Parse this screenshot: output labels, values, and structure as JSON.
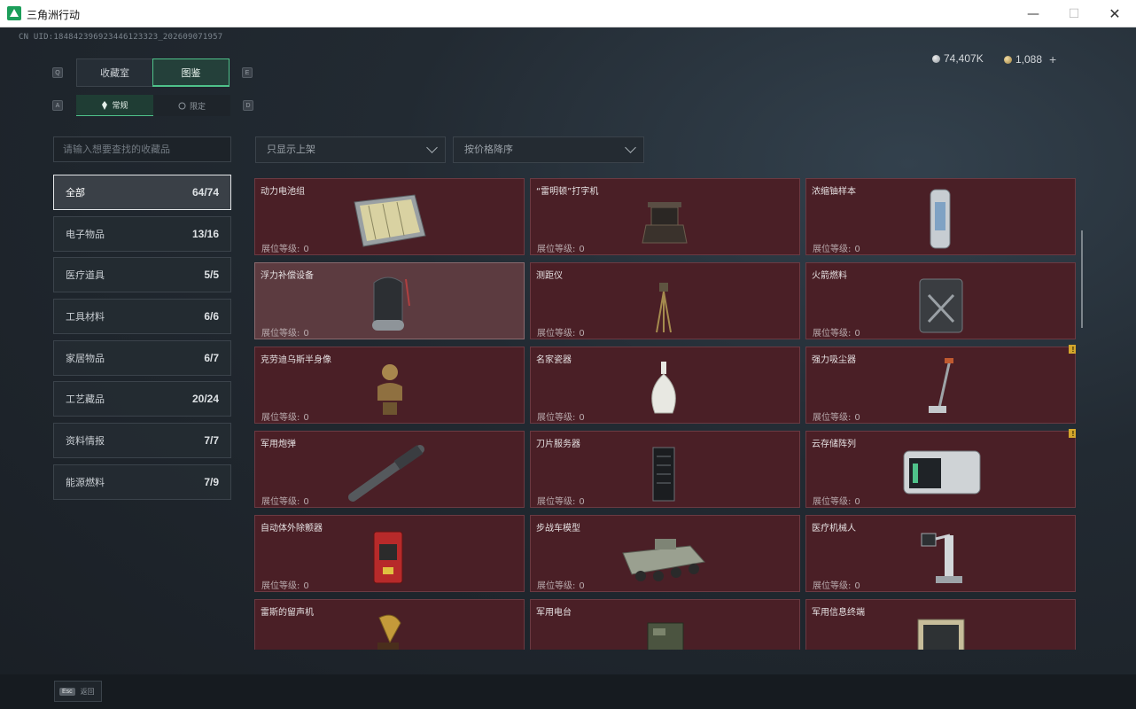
{
  "window": {
    "title": "三角洲行动",
    "minimize": "—",
    "maximize": "☐",
    "close": "✕"
  },
  "header": {
    "uid": "CN UID:1848423969234461233​23_202609071957",
    "silver": "74,407K",
    "gold": "1,088",
    "plus": "+",
    "keys": {
      "q": "Q",
      "e": "E",
      "a": "A",
      "d": "D"
    }
  },
  "tabs": {
    "collection": "收藏室",
    "atlas": "图鉴"
  },
  "subtabs": {
    "regular": "常规",
    "limited": "限定"
  },
  "search": {
    "placeholder": "请输入想要查找的收藏品"
  },
  "filters": {
    "shelf": "只显示上架",
    "sort": "按价格降序"
  },
  "categories": [
    {
      "label": "全部",
      "count": "64/74"
    },
    {
      "label": "电子物品",
      "count": "13/16"
    },
    {
      "label": "医疗道具",
      "count": "5/5"
    },
    {
      "label": "工具材料",
      "count": "6/6"
    },
    {
      "label": "家居物品",
      "count": "6/7"
    },
    {
      "label": "工艺藏品",
      "count": "20/24"
    },
    {
      "label": "资料情报",
      "count": "7/7"
    },
    {
      "label": "能源燃料",
      "count": "7/9"
    }
  ],
  "level_label": "展位等级:",
  "items": [
    {
      "name": "动力电池组",
      "level": "0",
      "icon": "battery-pack-icon"
    },
    {
      "name": "“雷明顿”打字机",
      "level": "0",
      "icon": "typewriter-icon"
    },
    {
      "name": "浓缩铀样本",
      "level": "0",
      "icon": "uranium-sample-icon"
    },
    {
      "name": "浮力补偿设备",
      "level": "0",
      "icon": "buoyancy-device-icon"
    },
    {
      "name": "测距仪",
      "level": "0",
      "icon": "rangefinder-icon"
    },
    {
      "name": "火箭燃料",
      "level": "0",
      "icon": "rocket-fuel-icon"
    },
    {
      "name": "克劳迪乌斯半身像",
      "level": "0",
      "icon": "bust-statue-icon"
    },
    {
      "name": "名家瓷器",
      "level": "0",
      "icon": "porcelain-vase-icon"
    },
    {
      "name": "强力吸尘器",
      "level": "0",
      "icon": "vacuum-cleaner-icon"
    },
    {
      "name": "军用炮弹",
      "level": "0",
      "icon": "artillery-shell-icon"
    },
    {
      "name": "刀片服务器",
      "level": "0",
      "icon": "blade-server-icon"
    },
    {
      "name": "云存储阵列",
      "level": "0",
      "icon": "storage-array-icon"
    },
    {
      "name": "自动体外除颤器",
      "level": "0",
      "icon": "defibrillator-icon"
    },
    {
      "name": "步战车模型",
      "level": "0",
      "icon": "ifv-model-icon"
    },
    {
      "name": "医疗机械人",
      "level": "0",
      "icon": "medical-robot-icon"
    },
    {
      "name": "雷斯的留声机",
      "level": "",
      "icon": "gramophone-icon"
    },
    {
      "name": "军用电台",
      "level": "",
      "icon": "military-radio-icon"
    },
    {
      "name": "军用信息终端",
      "level": "",
      "icon": "info-terminal-icon"
    }
  ],
  "warn_mark": "!",
  "footer": {
    "esc_key": "Esc",
    "esc_label": "返回"
  }
}
